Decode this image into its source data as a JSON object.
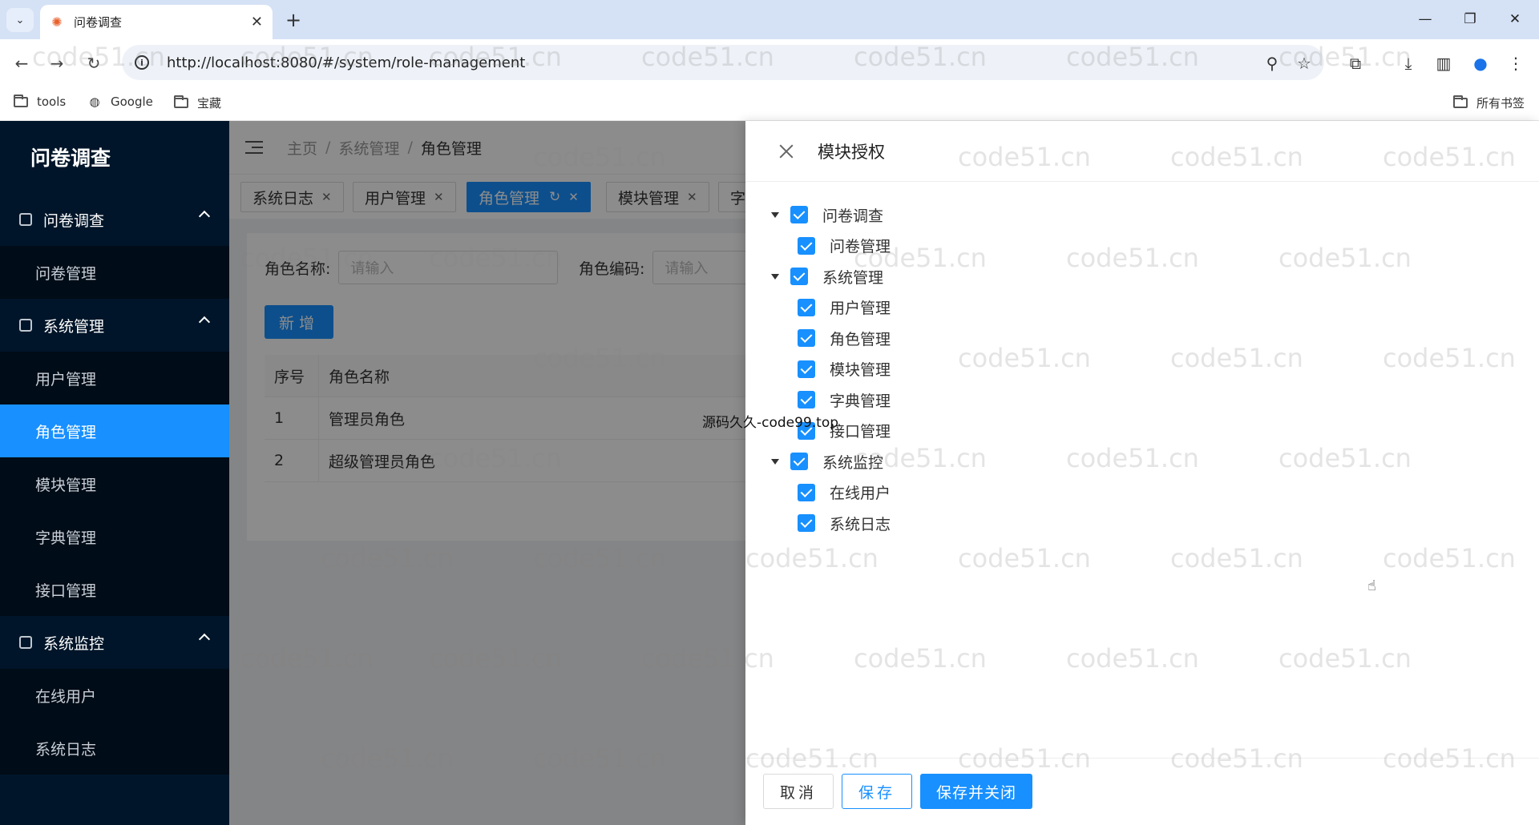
{
  "browser": {
    "tab_title": "问卷调查",
    "url": "http://localhost:8080/#/system/role-management",
    "bookmarks": [
      "tools",
      "Google",
      "宝藏"
    ],
    "all_bookmarks": "所有书签"
  },
  "sidebar": {
    "logo": "问卷调查",
    "groups": [
      {
        "label": "问卷调查",
        "items": [
          "问卷管理"
        ]
      },
      {
        "label": "系统管理",
        "items": [
          "用户管理",
          "角色管理",
          "模块管理",
          "字典管理",
          "接口管理"
        ]
      },
      {
        "label": "系统监控",
        "items": [
          "在线用户",
          "系统日志"
        ]
      }
    ],
    "active_item": "角色管理"
  },
  "header": {
    "breadcrumb": [
      "主页",
      "系统管理",
      "角色管理"
    ]
  },
  "tags": [
    "系统日志",
    "用户管理",
    "角色管理",
    "模块管理",
    "字"
  ],
  "search": {
    "role_name_label": "角色名称:",
    "role_name_placeholder": "请输入",
    "role_code_label": "角色编码:",
    "role_code_placeholder": "请输入",
    "add_label": "新增"
  },
  "table": {
    "headers": [
      "序号",
      "角色名称"
    ],
    "rows": [
      [
        "1",
        "管理员角色"
      ],
      [
        "2",
        "超级管理员角色"
      ]
    ]
  },
  "drawer": {
    "title": "模块授权",
    "tree": [
      {
        "label": "问卷调查",
        "checked": true,
        "children": [
          {
            "label": "问卷管理",
            "checked": true
          }
        ]
      },
      {
        "label": "系统管理",
        "checked": true,
        "children": [
          {
            "label": "用户管理",
            "checked": true
          },
          {
            "label": "角色管理",
            "checked": true
          },
          {
            "label": "模块管理",
            "checked": true
          },
          {
            "label": "字典管理",
            "checked": true
          },
          {
            "label": "接口管理",
            "checked": true
          }
        ]
      },
      {
        "label": "系统监控",
        "checked": true,
        "children": [
          {
            "label": "在线用户",
            "checked": true
          },
          {
            "label": "系统日志",
            "checked": true
          }
        ]
      }
    ],
    "cancel_label": "取消",
    "save_label": "保存",
    "save_close_label": "保存并关闭"
  },
  "overlay_text": "源码久久-code99.top",
  "watermark": "code51.cn",
  "colors": {
    "primary": "#1890ff",
    "sidebar": "#001529"
  }
}
